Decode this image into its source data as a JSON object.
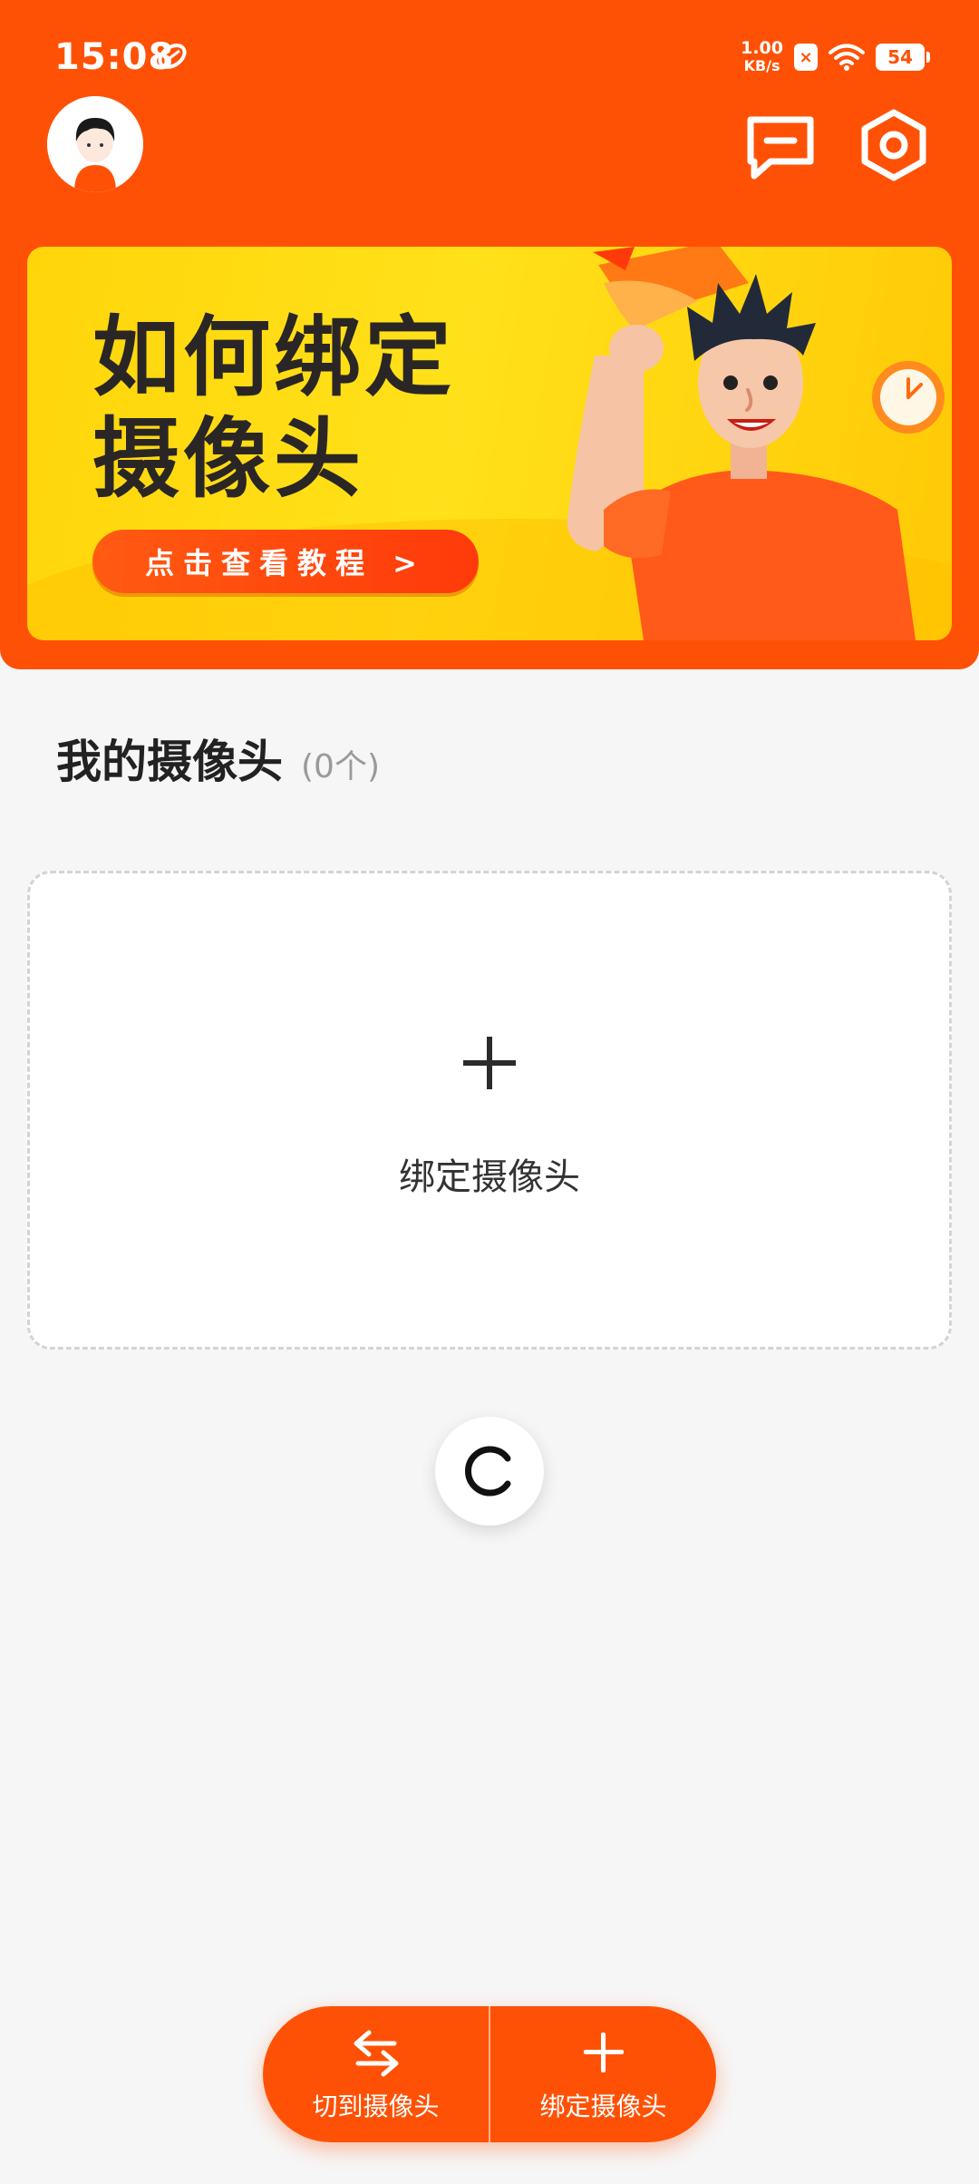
{
  "status_bar": {
    "time": "15:08",
    "net_speed_value": "1.00",
    "net_speed_unit": "KB/s",
    "battery": "54",
    "icons": [
      "app-notification-icon",
      "x-badge-icon",
      "wifi-icon",
      "battery-icon"
    ]
  },
  "header": {
    "avatar_icon": "avatar",
    "message_icon": "message-icon",
    "settings_icon": "settings-icon",
    "background_color": "#ff5106"
  },
  "banner": {
    "title_line1": "如何绑定",
    "title_line2": "摄像头",
    "button_label": "点击查看教程 >",
    "background_color": "#ffd50a"
  },
  "section": {
    "title": "我的摄像头",
    "count": "(0个)"
  },
  "empty_card": {
    "label": "绑定摄像头",
    "icon": "plus-icon"
  },
  "refresh": {
    "icon": "refresh-icon"
  },
  "action_bar": {
    "switch_label": "切到摄像头",
    "switch_icon": "swap-arrows-icon",
    "bind_label": "绑定摄像头",
    "bind_icon": "plus-icon",
    "color": "#ff5106"
  }
}
